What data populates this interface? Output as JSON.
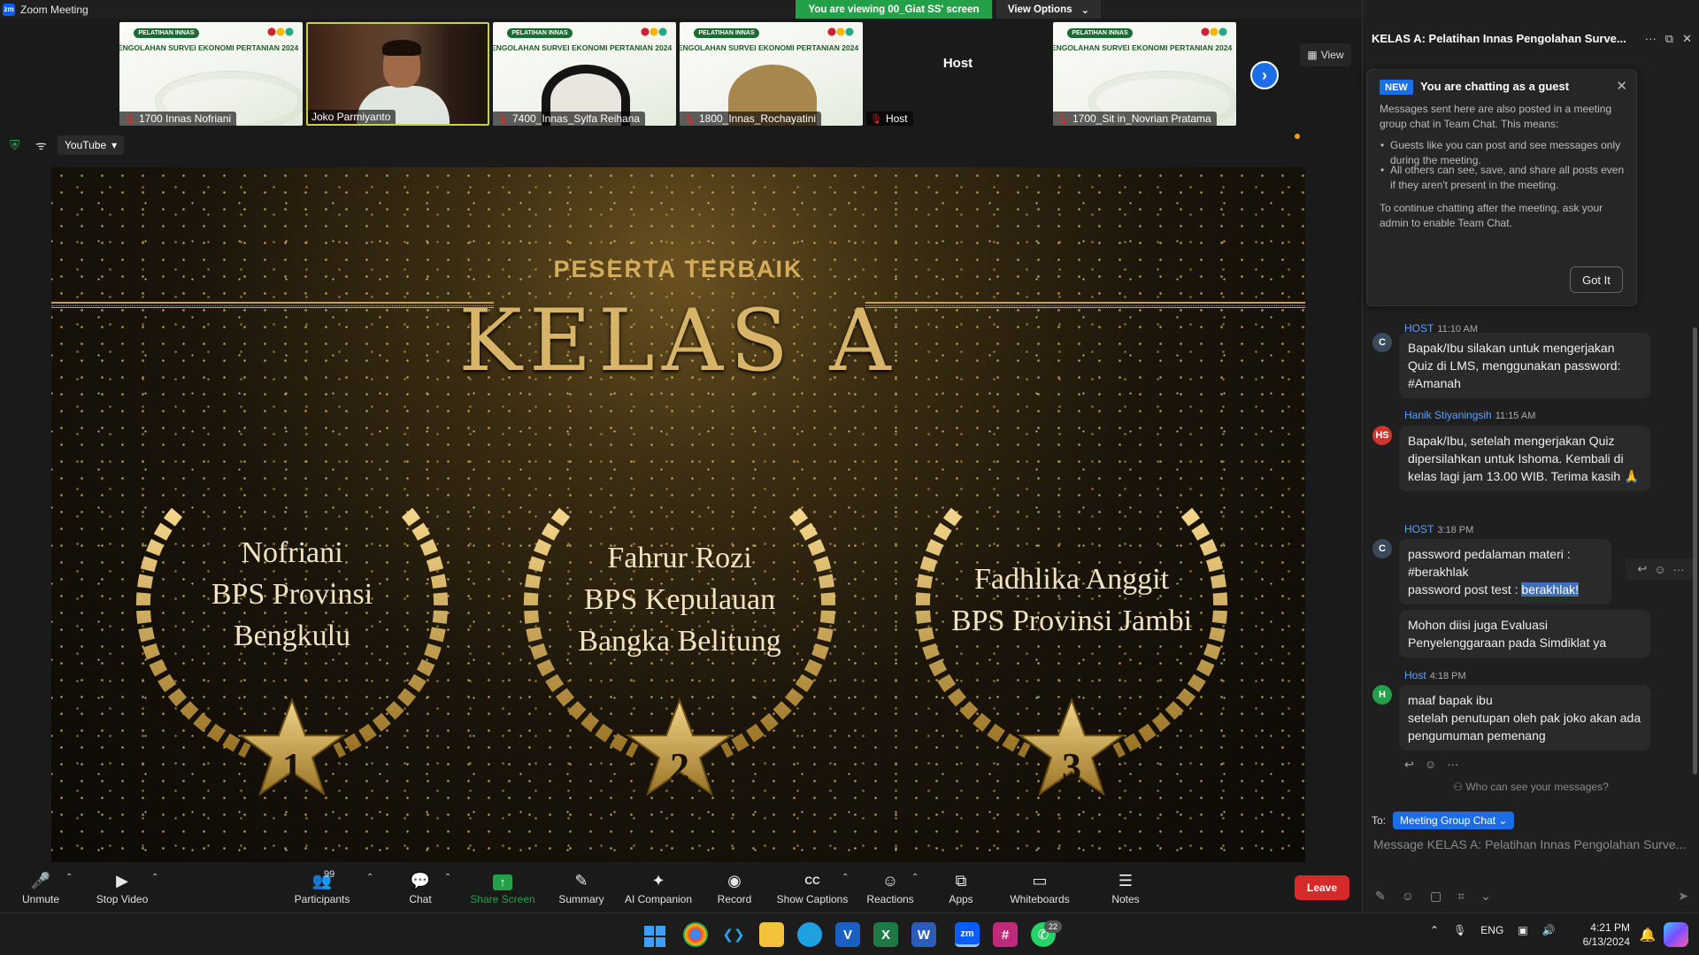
{
  "window": {
    "app_title": "Zoom Meeting",
    "viewing_banner": "You are viewing 00_Giat SS' screen",
    "view_options": "View Options",
    "controls": [
      "–",
      "❐",
      "✕"
    ]
  },
  "gallery": {
    "tiles": [
      {
        "name": "1700 Innas Nofriani",
        "kind": "slide",
        "muted": true
      },
      {
        "name": "Joko Parmiyanto",
        "kind": "camera",
        "muted": false
      },
      {
        "name": "7400_Innas_Sylfa Reihana",
        "kind": "slide",
        "muted": true
      },
      {
        "name": "1800_Innas_Rochayatini",
        "kind": "slide",
        "muted": true
      },
      {
        "name": "Host",
        "kind": "host",
        "muted": true,
        "center_label": "Host"
      },
      {
        "name": "1700_Sit in_Novrian Pratama",
        "kind": "slide",
        "muted": true
      }
    ],
    "slide_thumb_tag": "PELATIHAN INNAS",
    "slide_thumb_title": "ENGOLAHAN SURVEI EKONOMI PERTANIAN 2024",
    "view_button": "View"
  },
  "share": {
    "youtube_button": "YouTube",
    "slide": {
      "heading": "PESERTA TERBAIK",
      "title": "KELAS A",
      "winners": [
        {
          "rank": "1",
          "lines": [
            "Nofriani",
            "BPS Provinsi",
            "Bengkulu"
          ]
        },
        {
          "rank": "2",
          "lines": [
            "Fahrur Rozi",
            "BPS Kepulauan",
            "Bangka Belitung"
          ]
        },
        {
          "rank": "3",
          "lines": [
            "Fadhlika Anggit",
            "BPS Provinsi Jambi"
          ]
        }
      ]
    }
  },
  "toolbar": {
    "items": [
      {
        "label": "Unmute",
        "icon": "mic-off-icon",
        "glyph": "🎤"
      },
      {
        "label": "Stop Video",
        "icon": "video-icon",
        "glyph": "■"
      },
      {
        "label": "Participants",
        "icon": "participants-icon",
        "glyph": "👥"
      },
      {
        "label": "Chat",
        "icon": "chat-icon",
        "glyph": "💬"
      },
      {
        "label": "Share Screen",
        "icon": "share-screen-icon",
        "glyph": "↑"
      },
      {
        "label": "Summary",
        "icon": "summary-icon",
        "glyph": "✎"
      },
      {
        "label": "AI Companion",
        "icon": "ai-sparkle-icon",
        "glyph": "✦"
      },
      {
        "label": "Record",
        "icon": "record-icon",
        "glyph": "◉"
      },
      {
        "label": "Show Captions",
        "icon": "captions-icon",
        "glyph": "CC"
      },
      {
        "label": "Reactions",
        "icon": "reactions-icon",
        "glyph": "☺"
      },
      {
        "label": "Apps",
        "icon": "apps-icon",
        "glyph": "⧉"
      },
      {
        "label": "Whiteboards",
        "icon": "whiteboard-icon",
        "glyph": "▭"
      },
      {
        "label": "Notes",
        "icon": "notes-icon",
        "glyph": "☰"
      }
    ],
    "participants_count": "99",
    "leave": "Leave"
  },
  "chat": {
    "title": "KELAS A: Pelatihan Innas Pengolahan Surve...",
    "guest_notice": {
      "badge": "NEW",
      "heading": "You are chatting as a guest",
      "intro": "Messages sent here are also posted in a meeting group chat in Team Chat. This means:",
      "bullets": [
        "Guests like you can post and see messages only during the meeting.",
        "All others can see, save, and share all posts even if they aren't present in the meeting."
      ],
      "footer": "To continue chatting after the meeting, ask your admin to enable Team Chat.",
      "button": "Got It"
    },
    "messages": [
      {
        "avatar": "C",
        "avatar_color": "#3b4a5a",
        "sender": "HOST",
        "time": "11:10 AM",
        "text": "Bapak/Ibu silakan untuk mengerjakan Quiz di LMS, menggunakan password: #Amanah"
      },
      {
        "avatar": "HS",
        "avatar_color": "#d0342c",
        "sender": "Hanik Stiyaningsih",
        "time": "11:15 AM",
        "text": "Bapak/Ibu, setelah mengerjakan Quiz dipersilahkan untuk Ishoma. Kembali di kelas lagi jam 13.00 WIB. Terima kasih 🙏"
      },
      {
        "avatar": "C",
        "avatar_color": "#3b4a5a",
        "sender": "HOST",
        "time": "3:18 PM",
        "line1": "password pedalaman materi :",
        "line2": "#berakhlak",
        "line3_prefix": "password post test : ",
        "line3_highlight": "berakhlak!"
      },
      {
        "text": "Mohon diisi juga Evaluasi Penyelenggaraan pada Simdiklat ya"
      },
      {
        "avatar": "H",
        "avatar_color": "#24a148",
        "sender": "Host",
        "time": "4:18 PM",
        "text": "maaf bapak ibu\nsetelah penutupan oleh pak joko akan ada pengumuman pemenang"
      }
    ],
    "who_can_see": "Who can see your messages?",
    "to_label": "To:",
    "recipient": "Meeting Group Chat",
    "input_placeholder": "Message KELAS A: Pelatihan Innas Pengolahan Surve..."
  },
  "taskbar": {
    "language": "ENG",
    "time": "4:21 PM",
    "date": "6/13/2024",
    "whatsapp_badge": "22"
  },
  "colors": {
    "accent_blue": "#1c6de8",
    "share_green": "#24a148",
    "leave_red": "#d42a2a",
    "gold": "#d4ac5a"
  }
}
